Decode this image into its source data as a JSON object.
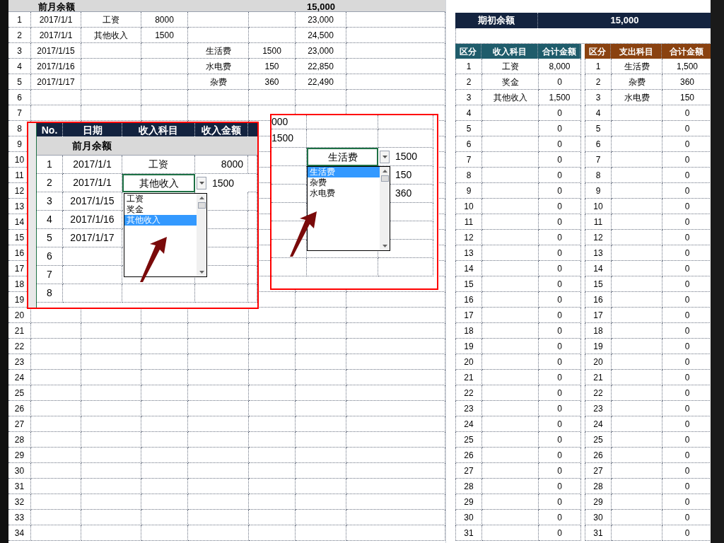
{
  "sheet": {
    "header": {
      "label": "前月余额",
      "balance": "15,000"
    },
    "rows": [
      {
        "no": "1",
        "date": "2017/1/1",
        "income_item": "工资",
        "income_amount": "8000",
        "balance": "23,000"
      },
      {
        "no": "2",
        "date": "2017/1/1",
        "income_item": "其他收入",
        "income_amount": "1500",
        "balance": "24,500"
      },
      {
        "no": "3",
        "date": "2017/1/15",
        "expense_item": "生活费",
        "expense_amount": "1500",
        "balance": "23,000"
      },
      {
        "no": "4",
        "date": "2017/1/16",
        "expense_item": "水电费",
        "expense_amount": "150",
        "balance": "22,850"
      },
      {
        "no": "5",
        "date": "2017/1/17",
        "expense_item": "杂费",
        "expense_amount": "360",
        "balance": "22,490"
      },
      {
        "no": "6"
      },
      {
        "no": "7"
      },
      {
        "no": "8"
      },
      {
        "no": "9"
      },
      {
        "no": "10"
      },
      {
        "no": "11"
      },
      {
        "no": "12"
      },
      {
        "no": "13"
      },
      {
        "no": "14"
      },
      {
        "no": "15"
      },
      {
        "no": "16"
      },
      {
        "no": "17"
      },
      {
        "no": "18"
      },
      {
        "no": "19"
      },
      {
        "no": "20"
      },
      {
        "no": "21"
      },
      {
        "no": "22"
      },
      {
        "no": "23"
      },
      {
        "no": "24"
      },
      {
        "no": "25"
      },
      {
        "no": "26"
      },
      {
        "no": "27"
      },
      {
        "no": "28"
      },
      {
        "no": "29"
      },
      {
        "no": "30"
      },
      {
        "no": "31"
      },
      {
        "no": "32"
      },
      {
        "no": "33"
      },
      {
        "no": "34"
      }
    ]
  },
  "inset_income": {
    "columns": [
      "No.",
      "日期",
      "收入科目",
      "收入金额"
    ],
    "balance_label": "前月余额",
    "rows": [
      {
        "no": "1",
        "date": "2017/1/1",
        "item": "工资",
        "amount": "8000",
        "selected": false
      },
      {
        "no": "2",
        "date": "2017/1/1",
        "item": "其他收入",
        "amount": "1500",
        "selected": true
      },
      {
        "no": "3",
        "date": "2017/1/15",
        "selected": false
      },
      {
        "no": "4",
        "date": "2017/1/16",
        "selected": false
      },
      {
        "no": "5",
        "date": "2017/1/17",
        "selected": false
      },
      {
        "no": "6",
        "selected": false
      },
      {
        "no": "7",
        "selected": false
      },
      {
        "no": "8",
        "selected": false
      }
    ],
    "options": [
      {
        "label": "工资",
        "selected": false
      },
      {
        "label": "奖金",
        "selected": false
      },
      {
        "label": "其他收入",
        "selected": true
      }
    ]
  },
  "inset_expense": {
    "rows_top": [
      {
        "amount_left": "000"
      },
      {
        "amount_left": "1500"
      }
    ],
    "active_row": {
      "item": "生活费",
      "amount": "1500"
    },
    "rows_bottom": [
      {
        "amount": "150"
      },
      {
        "amount": "360"
      }
    ],
    "options": [
      {
        "label": "生活费",
        "selected": true
      },
      {
        "label": "杂费",
        "selected": false
      },
      {
        "label": "水电费",
        "selected": false
      }
    ]
  },
  "summary": {
    "opening_label": "期初余额",
    "opening_balance": "15,000",
    "income": {
      "columns": [
        "区分",
        "收入科目",
        "合计金额"
      ],
      "rows": [
        {
          "no": "1",
          "item": "工资",
          "amount": "8,000"
        },
        {
          "no": "2",
          "item": "奖金",
          "amount": "0"
        },
        {
          "no": "3",
          "item": "其他收入",
          "amount": "1,500"
        },
        {
          "no": "4",
          "amount": "0"
        },
        {
          "no": "5",
          "amount": "0"
        },
        {
          "no": "6",
          "amount": "0"
        },
        {
          "no": "7",
          "amount": "0"
        },
        {
          "no": "8",
          "amount": "0"
        },
        {
          "no": "9",
          "amount": "0"
        },
        {
          "no": "10",
          "amount": "0"
        },
        {
          "no": "11",
          "amount": "0"
        },
        {
          "no": "12",
          "amount": "0"
        },
        {
          "no": "13",
          "amount": "0"
        },
        {
          "no": "14",
          "amount": "0"
        },
        {
          "no": "15",
          "amount": "0"
        },
        {
          "no": "16",
          "amount": "0"
        },
        {
          "no": "17",
          "amount": "0"
        },
        {
          "no": "18",
          "amount": "0"
        },
        {
          "no": "19",
          "amount": "0"
        },
        {
          "no": "20",
          "amount": "0"
        },
        {
          "no": "21",
          "amount": "0"
        },
        {
          "no": "22",
          "amount": "0"
        },
        {
          "no": "23",
          "amount": "0"
        },
        {
          "no": "24",
          "amount": "0"
        },
        {
          "no": "25",
          "amount": "0"
        },
        {
          "no": "26",
          "amount": "0"
        },
        {
          "no": "27",
          "amount": "0"
        },
        {
          "no": "28",
          "amount": "0"
        },
        {
          "no": "29",
          "amount": "0"
        },
        {
          "no": "30",
          "amount": "0"
        },
        {
          "no": "31",
          "amount": "0"
        }
      ]
    },
    "expense": {
      "columns": [
        "区分",
        "支出科目",
        "合计金额"
      ],
      "rows": [
        {
          "no": "1",
          "item": "生活费",
          "amount": "1,500"
        },
        {
          "no": "2",
          "item": "杂费",
          "amount": "360"
        },
        {
          "no": "3",
          "item": "水电费",
          "amount": "150"
        },
        {
          "no": "4",
          "amount": "0"
        },
        {
          "no": "5",
          "amount": "0"
        },
        {
          "no": "6",
          "amount": "0"
        },
        {
          "no": "7",
          "amount": "0"
        },
        {
          "no": "8",
          "amount": "0"
        },
        {
          "no": "9",
          "amount": "0"
        },
        {
          "no": "10",
          "amount": "0"
        },
        {
          "no": "11",
          "amount": "0"
        },
        {
          "no": "12",
          "amount": "0"
        },
        {
          "no": "13",
          "amount": "0"
        },
        {
          "no": "14",
          "amount": "0"
        },
        {
          "no": "15",
          "amount": "0"
        },
        {
          "no": "16",
          "amount": "0"
        },
        {
          "no": "17",
          "amount": "0"
        },
        {
          "no": "18",
          "amount": "0"
        },
        {
          "no": "19",
          "amount": "0"
        },
        {
          "no": "20",
          "amount": "0"
        },
        {
          "no": "21",
          "amount": "0"
        },
        {
          "no": "22",
          "amount": "0"
        },
        {
          "no": "23",
          "amount": "0"
        },
        {
          "no": "24",
          "amount": "0"
        },
        {
          "no": "25",
          "amount": "0"
        },
        {
          "no": "26",
          "amount": "0"
        },
        {
          "no": "27",
          "amount": "0"
        },
        {
          "no": "28",
          "amount": "0"
        },
        {
          "no": "29",
          "amount": "0"
        },
        {
          "no": "30",
          "amount": "0"
        },
        {
          "no": "31",
          "amount": "0"
        }
      ]
    }
  }
}
